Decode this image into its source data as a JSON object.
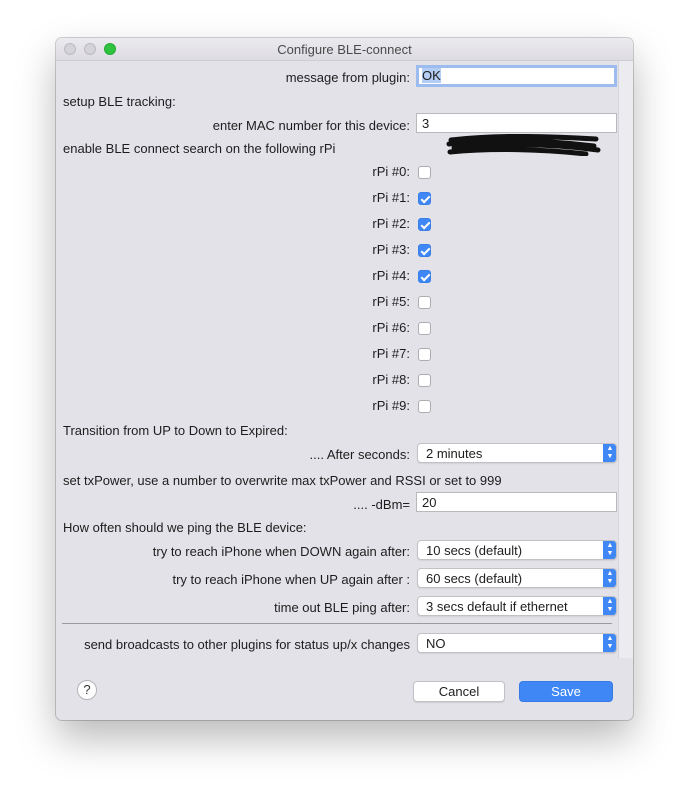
{
  "window": {
    "title": "Configure BLE-connect"
  },
  "form": {
    "message_label": "message from plugin:",
    "message_value": "OK",
    "setup_heading": "setup BLE tracking:",
    "mac_label": "enter MAC number for this device:",
    "mac_value": "3",
    "rpi_heading": "enable BLE connect search on the following rPi",
    "rpi": [
      {
        "label": "rPi #0:",
        "checked": false
      },
      {
        "label": "rPi #1:",
        "checked": true
      },
      {
        "label": "rPi #2:",
        "checked": true
      },
      {
        "label": "rPi #3:",
        "checked": true
      },
      {
        "label": "rPi #4:",
        "checked": true
      },
      {
        "label": "rPi #5:",
        "checked": false
      },
      {
        "label": "rPi #6:",
        "checked": false
      },
      {
        "label": "rPi #7:",
        "checked": false
      },
      {
        "label": "rPi #8:",
        "checked": false
      },
      {
        "label": "rPi #9:",
        "checked": false
      }
    ],
    "transition_heading": "Transition from UP to Down to Expired:",
    "after_label": "....  After seconds:",
    "after_value": "2 minutes",
    "txpower_heading": "set txPower, use a number to overwrite max txPower and RSSI or set to 999",
    "dbm_label": ".... -dBm=",
    "dbm_value": "20",
    "ping_heading": "How often should we ping the BLE device:",
    "down_label": "try to reach iPhone when DOWN again after:",
    "down_value": " 10 secs (default)",
    "up_label": "try to reach iPhone when UP again after :",
    "up_value": "60 secs  (default)",
    "timeout_label": "time out BLE ping after:",
    "timeout_value": " 3 secs default if ethernet",
    "broadcast_label": "send broadcasts to other plugins for status up/x changes",
    "broadcast_value": "NO"
  },
  "buttons": {
    "help": "?",
    "cancel": "Cancel",
    "save": "Save"
  },
  "colors": {
    "accent": "#3f87f5",
    "window_bg": "#e4e2e9",
    "close_green": "#2fc340"
  },
  "icons": {
    "popup_arrows": "chevron-up-down-icon",
    "help": "question-icon",
    "redaction": "redaction-scribble"
  }
}
